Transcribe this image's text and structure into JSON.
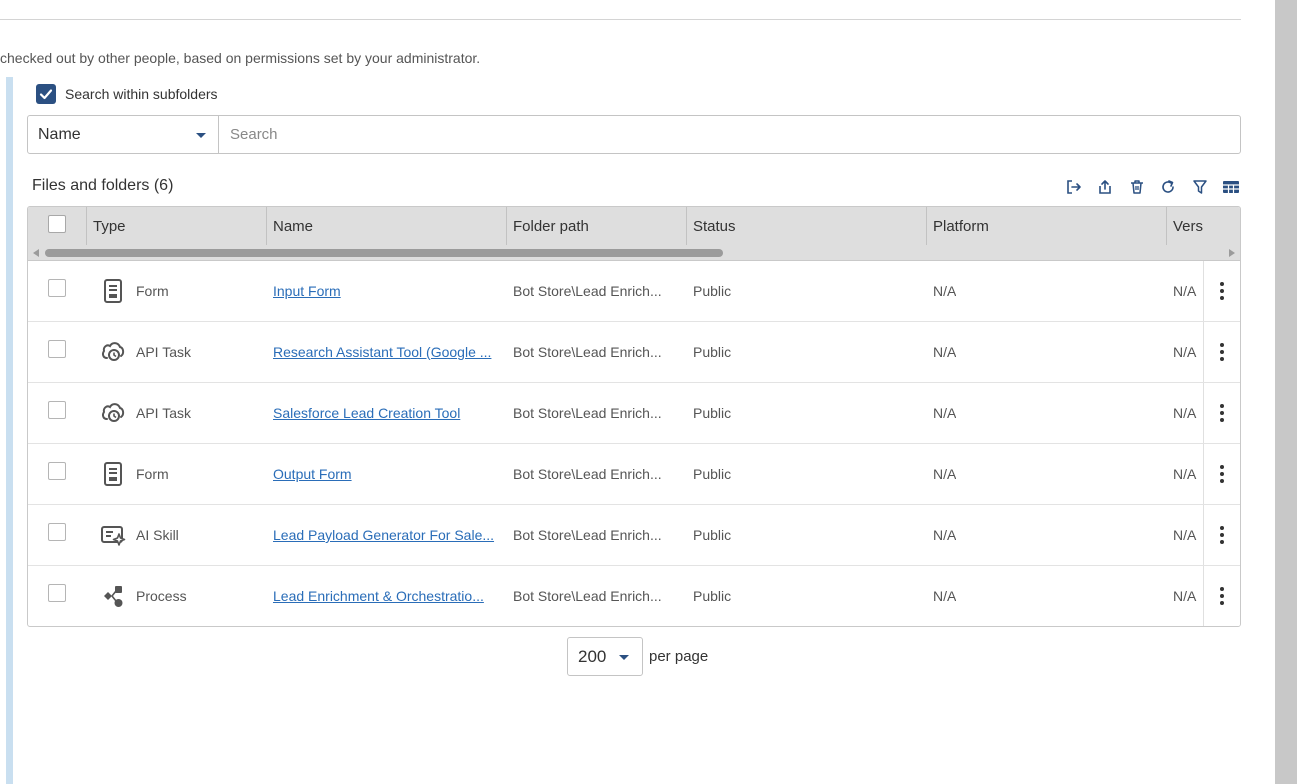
{
  "info_text": "checked out by other people, based on permissions set by your administrator.",
  "search_within_subfolders": {
    "label": "Search within subfolders",
    "checked": true
  },
  "search": {
    "field": "Name",
    "placeholder": "Search"
  },
  "section_title": "Files and folders (6)",
  "toolbar": [
    "checkout-icon",
    "export-icon",
    "delete-icon",
    "refresh-icon",
    "filter-icon",
    "table-columns-icon"
  ],
  "columns": [
    "Type",
    "Name",
    "Folder path",
    "Status",
    "Platform",
    "Vers"
  ],
  "rows": [
    {
      "type": "Form",
      "icon": "form-icon",
      "name": "Input Form",
      "folder": "Bot Store\\Lead Enrich...",
      "status": "Public",
      "platform": "N/A",
      "version": "N/A"
    },
    {
      "type": "API Task",
      "icon": "api-task-icon",
      "name": "Research Assistant Tool (Google ...",
      "folder": "Bot Store\\Lead Enrich...",
      "status": "Public",
      "platform": "N/A",
      "version": "N/A"
    },
    {
      "type": "API Task",
      "icon": "api-task-icon",
      "name": "Salesforce Lead Creation Tool",
      "folder": "Bot Store\\Lead Enrich...",
      "status": "Public",
      "platform": "N/A",
      "version": "N/A"
    },
    {
      "type": "Form",
      "icon": "form-icon",
      "name": "Output Form",
      "folder": "Bot Store\\Lead Enrich...",
      "status": "Public",
      "platform": "N/A",
      "version": "N/A"
    },
    {
      "type": "AI Skill",
      "icon": "ai-skill-icon",
      "name": "Lead Payload Generator For Sale...",
      "folder": "Bot Store\\Lead Enrich...",
      "status": "Public",
      "platform": "N/A",
      "version": "N/A"
    },
    {
      "type": "Process",
      "icon": "process-icon",
      "name": "Lead Enrichment & Orchestratio...",
      "folder": "Bot Store\\Lead Enrich...",
      "status": "Public",
      "platform": "N/A",
      "version": "N/A"
    }
  ],
  "pagination": {
    "page_size": "200",
    "label": "per page"
  },
  "colors": {
    "accent": "#2b5082",
    "link": "#2a6db8",
    "header_bg": "#dedede"
  }
}
